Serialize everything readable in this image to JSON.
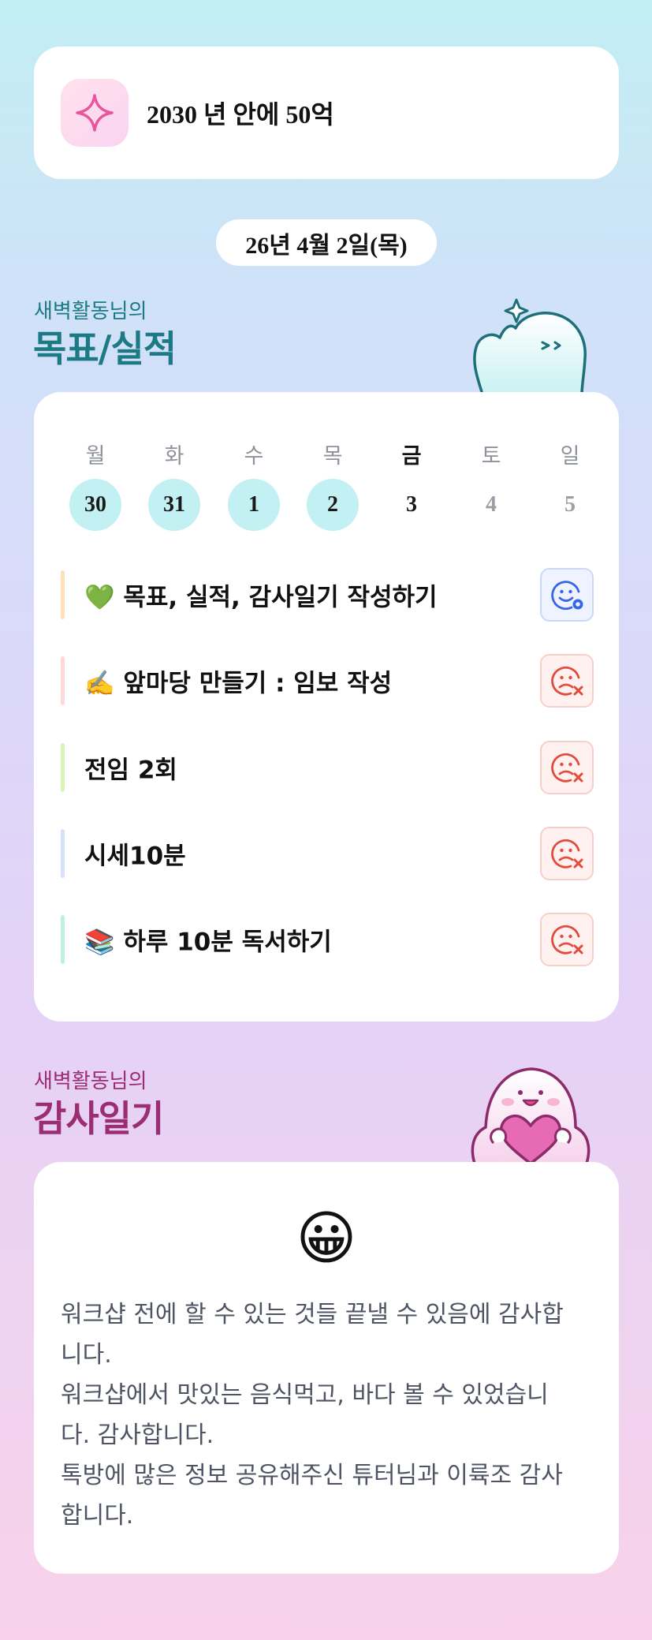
{
  "goal": {
    "icon": "sparkle-icon",
    "text": "2030 년 안에 50억"
  },
  "date": "26년 4월 2일(목)",
  "goals_section": {
    "subtitle": "새벽활동님의",
    "title": "목표/실적",
    "mascot": "waving-mascot"
  },
  "week": {
    "days_of_week": [
      "월",
      "화",
      "수",
      "목",
      "금",
      "토",
      "일"
    ],
    "dates": [
      "30",
      "31",
      "1",
      "2",
      "3",
      "4",
      "5"
    ],
    "today_index": 4,
    "completed": [
      true,
      true,
      true,
      true,
      false,
      false,
      false
    ]
  },
  "tasks": [
    {
      "label": "💚 목표, 실적, 감사일기 작성하기",
      "bar_color": "#ffe0b8",
      "status": "done",
      "icon": "smile-check-icon"
    },
    {
      "label": "✍️ 앞마당 만들기 : 임보 작성",
      "bar_color": "#ffd9d9",
      "status": "not-done",
      "icon": "sad-x-icon"
    },
    {
      "label": "전임 2회",
      "bar_color": "#d9f3b8",
      "status": "not-done",
      "icon": "sad-x-icon"
    },
    {
      "label": "시세10분",
      "bar_color": "#d8e1fb",
      "status": "not-done",
      "icon": "sad-x-icon"
    },
    {
      "label": "📚 하루 10분 독서하기",
      "bar_color": "#bff0dc",
      "status": "not-done",
      "icon": "sad-x-icon"
    }
  ],
  "diary_section": {
    "subtitle": "새벽활동님의",
    "title": "감사일기",
    "mascot": "heart-hugging-mascot"
  },
  "diary": {
    "emoji": "😀",
    "text": "워크샵 전에 할 수 있는 것들 끝낼 수 있음에 감사합\n니다.\n워크샵에서 맛있는 음식먹고, 바다 볼 수 있었습니\n다. 감사합니다.\n톡방에 많은 정보 공유해주신 튜터님과 이륙조 감사\n합니다."
  },
  "colors": {
    "accent_teal": "#1c7a85",
    "accent_plum": "#9b2d73",
    "done_circle": "#c3f0f2",
    "ok_icon": "#3566e8",
    "fail_icon": "#e24c3c"
  }
}
